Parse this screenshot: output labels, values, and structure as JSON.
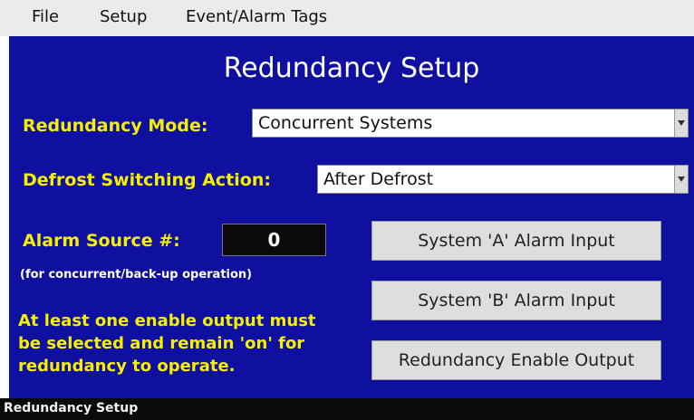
{
  "menubar": {
    "items": [
      "File",
      "Setup",
      "Event/Alarm Tags"
    ]
  },
  "screen": {
    "title": "Redundancy Setup",
    "redundancy_mode": {
      "label": "Redundancy Mode:",
      "value": "Concurrent Systems"
    },
    "defrost_action": {
      "label": "Defrost Switching Action:",
      "value": "After Defrost"
    },
    "alarm_source": {
      "label": "Alarm Source #:",
      "value": "0",
      "note": "(for concurrent/back-up operation)"
    },
    "message": [
      "At least one enable output must",
      "be selected and remain 'on' for",
      "redundancy to operate."
    ],
    "buttons": {
      "system_a": "System 'A' Alarm Input",
      "system_b": "System 'B' Alarm Input",
      "enable_output": "Redundancy Enable Output"
    }
  },
  "statusbar": {
    "text": "Redundancy Setup"
  },
  "colors": {
    "screen_bg": "#0f10a0",
    "label_yellow": "#f4f000",
    "menubar_bg": "#ebebeb"
  },
  "icons": {
    "dropdown": "chevron-down-icon"
  }
}
